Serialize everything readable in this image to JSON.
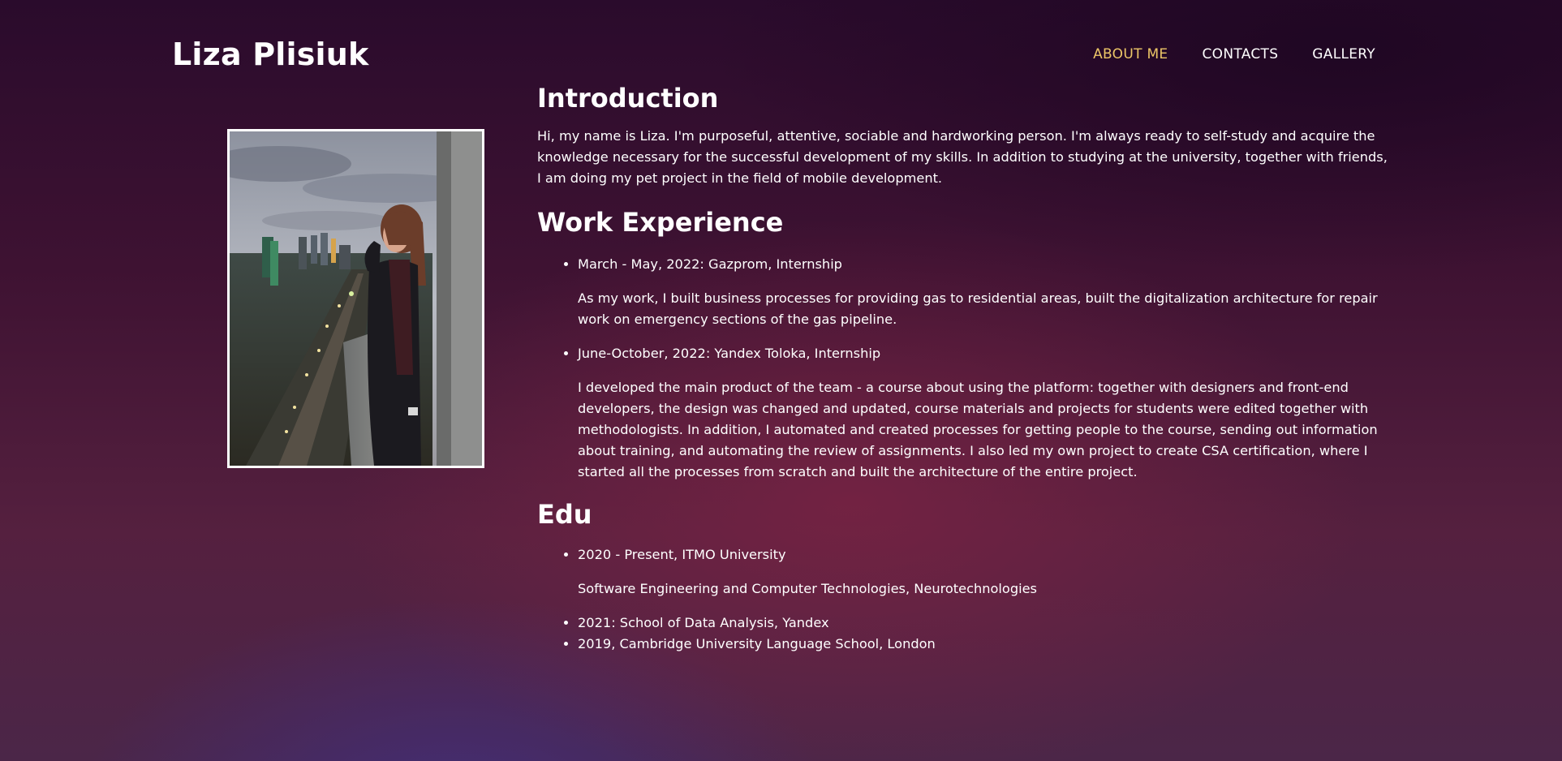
{
  "header": {
    "name": "Liza Plisiuk",
    "nav": [
      {
        "label": "ABOUT ME",
        "active": true
      },
      {
        "label": "CONTACTS",
        "active": false
      },
      {
        "label": "GALLERY",
        "active": false
      }
    ]
  },
  "colors": {
    "accent": "#ecc667",
    "text": "#ffffff",
    "background_dark": "#2a0b2c",
    "background_wine": "#7d2444",
    "background_violet": "#422e7a"
  },
  "intro": {
    "title": "Introduction",
    "text": "Hi, my name is Liza. I'm purposeful, attentive, sociable and hardworking person. I'm always ready to self-study and acquire the knowledge necessary for the successful development of my skills. In addition to studying at the university, together with friends, I am doing my pet project in the field of mobile development."
  },
  "work": {
    "title": "Work Experience",
    "items": [
      {
        "heading": "March - May, 2022: Gazprom, Internship",
        "description": "As my work, I built business processes for providing gas to residential areas, built the digitalization architecture for repair work on emergency sections of the gas pipeline."
      },
      {
        "heading": "June-October, 2022: Yandex Toloka, Internship",
        "description": "I developed the main product of the team - a course about using the platform: together with designers and front-end developers, the design was changed and updated, course materials and projects for students were edited together with methodologists. In addition, I automated and created processes for getting people to the course, sending out information about training, and automating the review of assignments. I also led my own project to create CSA certification, where I started all the processes from scratch and built the architecture of the entire project."
      }
    ]
  },
  "edu": {
    "title": "Edu",
    "items": [
      {
        "heading": "2020 - Present, ITMO University",
        "description": "Software Engineering and Computer Technologies, Neurotechnologies"
      },
      {
        "heading": "2021: School of Data Analysis, Yandex"
      },
      {
        "heading": "2019, Cambridge University Language School, London"
      }
    ]
  }
}
